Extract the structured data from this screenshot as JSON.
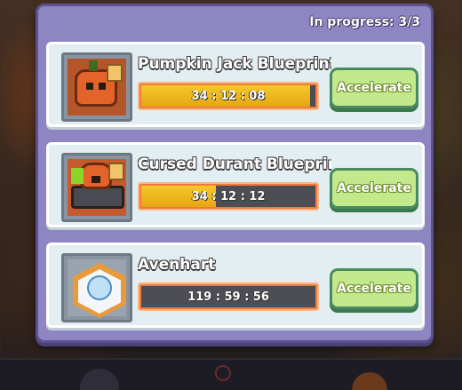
{
  "status": {
    "label": "In progress: 3/3"
  },
  "queue": [
    {
      "title": "Pumpkin Jack Blueprint",
      "timer": "34 : 12 : 08",
      "progress": 0.97,
      "button": "Accelerate",
      "icon": "pumpkin-jack-icon"
    },
    {
      "title": "Cursed Durant Blueprint",
      "timer": "34 : 12 : 12",
      "progress": 0.43,
      "button": "Accelerate",
      "icon": "cursed-durant-icon"
    },
    {
      "title": "Avenhart",
      "timer": "119 : 59 : 56",
      "progress": 0.0,
      "button": "Accelerate",
      "icon": "avenhart-portrait-icon"
    }
  ],
  "colors": {
    "panel": "#8e86c2",
    "card": "#e3eef2",
    "progress_fill": "#f4c928",
    "button": "#c2ea8c"
  }
}
